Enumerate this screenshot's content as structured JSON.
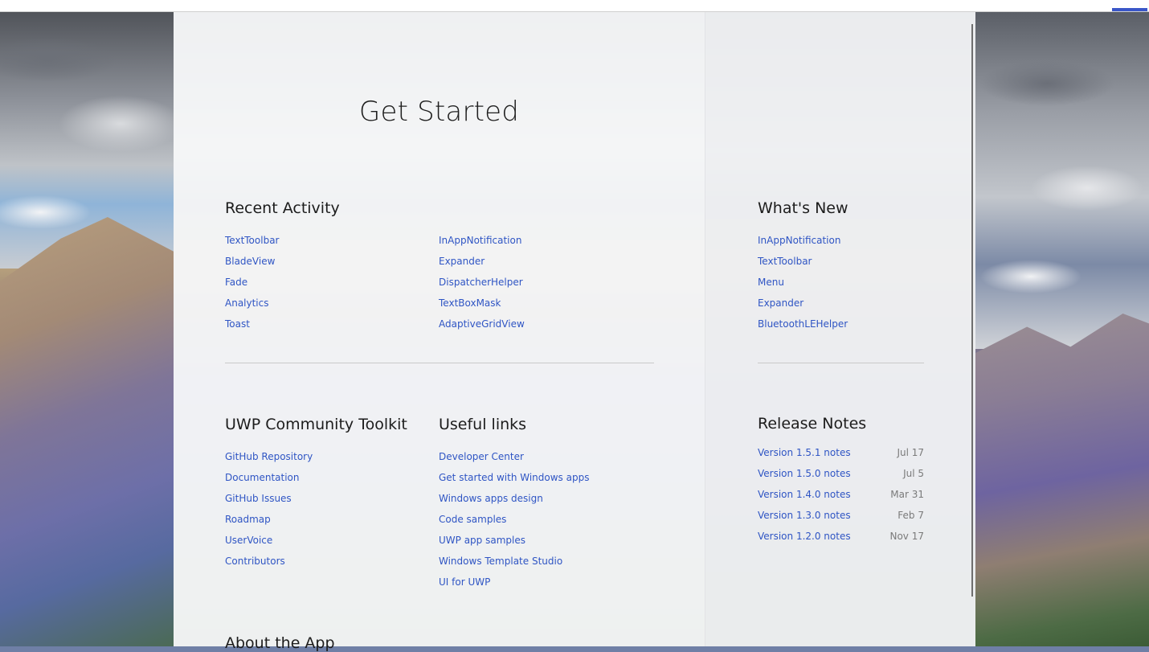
{
  "page": {
    "title": "Get Started"
  },
  "recent_activity": {
    "title": "Recent Activity",
    "column1": [
      "TextToolbar",
      "BladeView",
      "Fade",
      "Analytics",
      "Toast"
    ],
    "column2": [
      "InAppNotification",
      "Expander",
      "DispatcherHelper",
      "TextBoxMask",
      "AdaptiveGridView"
    ]
  },
  "toolkit": {
    "title": "UWP Community Toolkit",
    "links": [
      "GitHub Repository",
      "Documentation",
      "GitHub Issues",
      "Roadmap",
      "UserVoice",
      "Contributors"
    ]
  },
  "useful_links": {
    "title": "Useful links",
    "links": [
      "Developer Center",
      "Get started with Windows apps",
      "Windows apps design",
      "Code samples",
      "UWP app samples",
      "Windows Template Studio",
      "UI for UWP"
    ]
  },
  "about": {
    "title": "About the App"
  },
  "whats_new": {
    "title": "What's New",
    "links": [
      "InAppNotification",
      "TextToolbar",
      "Menu",
      "Expander",
      "BluetoothLEHelper"
    ]
  },
  "release_notes": {
    "title": "Release Notes",
    "items": [
      {
        "label": "Version 1.5.1 notes",
        "date": "Jul 17"
      },
      {
        "label": "Version 1.5.0 notes",
        "date": "Jul 5"
      },
      {
        "label": "Version 1.4.0 notes",
        "date": "Mar 31"
      },
      {
        "label": "Version 1.3.0 notes",
        "date": "Feb 7"
      },
      {
        "label": "Version 1.2.0 notes",
        "date": "Nov 17"
      }
    ]
  },
  "colors": {
    "link": "#2f55c4",
    "heading": "#1c1c1c",
    "date": "#7a7a7a",
    "accent": "#3a56c8"
  }
}
